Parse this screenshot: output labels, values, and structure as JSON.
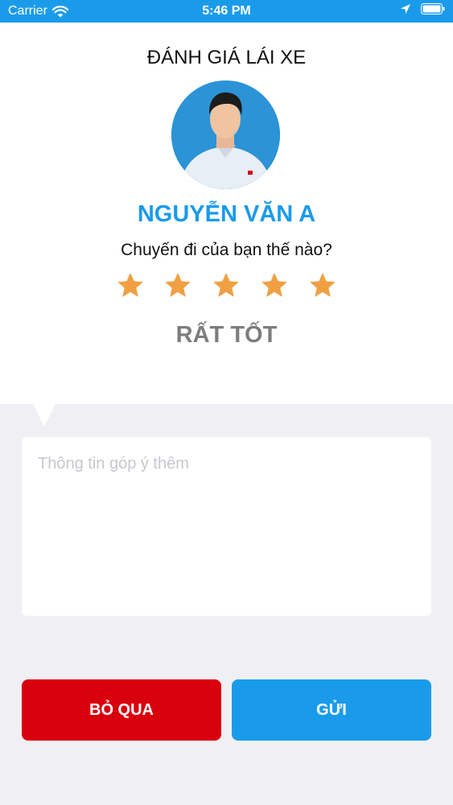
{
  "status_bar": {
    "carrier": "Carrier",
    "time": "5:46 PM",
    "icons": [
      "wifi-icon",
      "location-arrow-icon",
      "battery-icon"
    ]
  },
  "rating": {
    "title": "ĐÁNH GIÁ LÁI XE",
    "driver_name": "NGUYỄN VĂN A",
    "question": "Chuyến đi của bạn thế nào?",
    "stars_selected": 5,
    "stars_total": 5,
    "star_color": "#f0a042",
    "label": "RẤT TỐT"
  },
  "feedback": {
    "value": "",
    "placeholder": "Thông tin góp ý thêm"
  },
  "actions": {
    "skip_label": "BỎ QUA",
    "send_label": "GỬI"
  },
  "colors": {
    "accent": "#1a9bea",
    "danger": "#d9000d",
    "muted_text": "#7d7d7d",
    "background": "#efeff4"
  }
}
